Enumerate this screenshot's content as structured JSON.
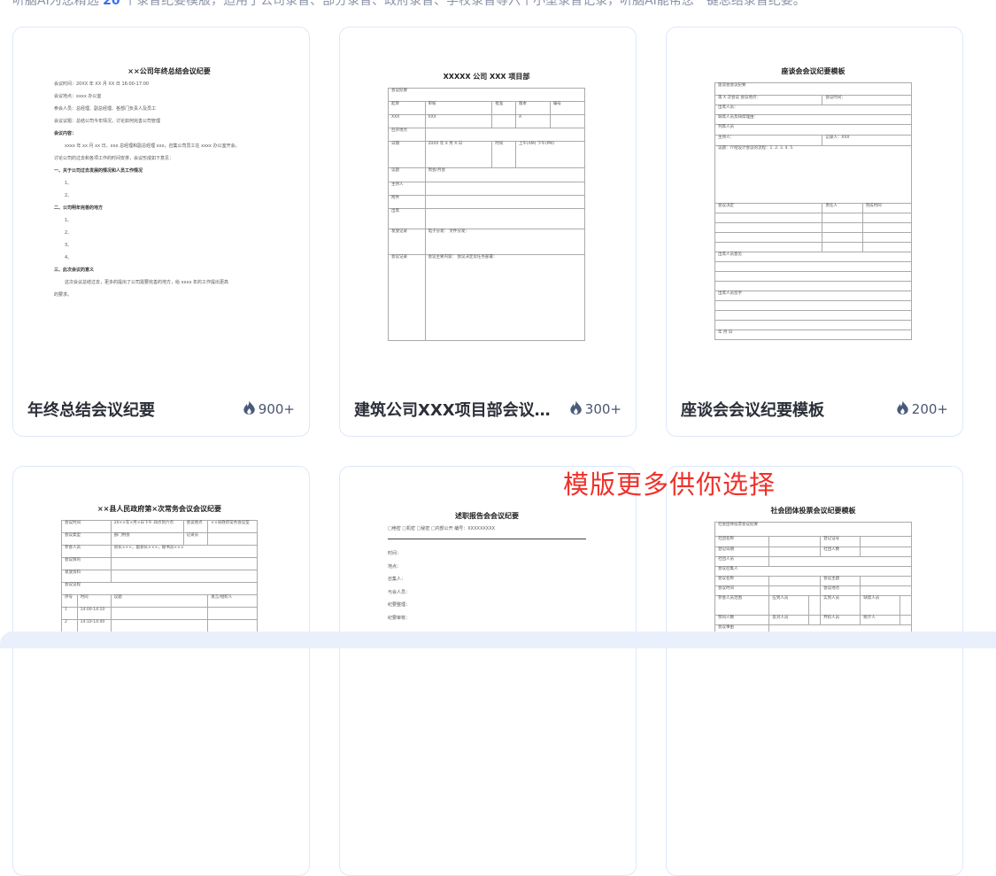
{
  "intro": {
    "prefix": "听脑AI为您精选",
    "count": "20",
    "suffix": "个录音纪要模版，适用于公司录音、部分录音、政府录音、学校录音等六个小型录音记录，听脑AI能帮您一键总结录音纪要。"
  },
  "promo_text": "模版更多供你选择",
  "colors": {
    "accent": "#3a6ff0",
    "promo": "#f0302a",
    "card_border": "#dde8fb",
    "band": "#e9f0fb"
  },
  "cards": [
    {
      "title": "年终总结会议纪要",
      "count": "900+",
      "icon": "flame-icon",
      "doc": {
        "type": "text",
        "title": "××公司年终总结会议纪要",
        "lines": [
          {
            "t": "会议时间：20XX 年 XX 月 XX 日 16:00-17:00"
          },
          {
            "t": "会议地点：xxxx 办公室"
          },
          {
            "t": "参会人员：总经理、副总经理、各部门负责人及员工"
          },
          {
            "t": "会议议题：总结公司今年情况，讨论如何完善公司管理"
          },
          {
            "t": "会议内容：",
            "b": true
          },
          {
            "t": "xxxx 年 xx 月 xx 日，xxx 总经理和副总经理 xxx，召集公司员工在 xxxx 办公室开会，",
            "i": true
          },
          {
            "t": "讨论公司的过去和各项工作的时间安排，会议形成如下意见："
          },
          {
            "t": "一、关于公司过去发展的情况和人员工作情况",
            "b": true
          },
          {
            "t": "1、",
            "i": true
          },
          {
            "t": "2、",
            "i": true
          },
          {
            "t": "二、公司明年完善的地方",
            "b": true
          },
          {
            "t": "1、",
            "i": true
          },
          {
            "t": "2、",
            "i": true
          },
          {
            "t": "3、",
            "i": true
          },
          {
            "t": "4、",
            "i": true
          },
          {
            "t": "三、此次会议的意义",
            "b": true
          },
          {
            "t": "这次会议总结过去，更多的提出了公司需要完善的地方，给 xxxx 年的工作提出更高",
            "i": true
          },
          {
            "t": "的要求。"
          }
        ]
      }
    },
    {
      "title": "建筑公司XXX项目部会议纪要",
      "count": "300+",
      "icon": "flame-icon",
      "doc": {
        "type": "table",
        "title": "XXXXX 公司 XXX 项目部",
        "rows": [
          [
            {
              "t": "会议纪要",
              "s": 5
            }
          ],
          [
            {
              "t": "起草"
            },
            {
              "t": "审核"
            },
            {
              "t": "批准"
            },
            {
              "t": "版本"
            },
            {
              "t": "编号"
            }
          ],
          [
            {
              "t": "XXX"
            },
            {
              "t": "XXX"
            },
            {
              "t": ""
            },
            {
              "t": "A"
            },
            {
              "t": ""
            }
          ],
          [
            {
              "t": "召开地点"
            },
            {
              "t": "",
              "s": 4
            }
          ],
          [
            {
              "t": "日期"
            },
            {
              "t": "20XX 年 X 月 X 日"
            },
            {
              "t": "时间"
            },
            {
              "t": "上午(AM)  下午(PM)",
              "s": 2
            }
          ],
          [
            {
              "t": "议题"
            },
            {
              "t": "周会/月会",
              "s": 4
            }
          ],
          [
            {
              "t": "主持人"
            },
            {
              "t": "",
              "s": 4
            }
          ],
          [
            {
              "t": "附件"
            },
            {
              "t": "",
              "s": 4
            }
          ],
          [
            {
              "t": "出席"
            },
            {
              "t": "",
              "s": 4
            }
          ],
          [
            {
              "t": "发放记录"
            },
            {
              "t": "电子分发：  文件分发：",
              "s": 4
            }
          ],
          [
            {
              "t": "会议记录"
            },
            {
              "t": "会议主要内容：  会议决定及任务部署：",
              "s": 4
            }
          ]
        ]
      }
    },
    {
      "title": "座谈会会议纪要模板",
      "count": "200+",
      "icon": "flame-icon",
      "doc": {
        "type": "table",
        "title": "座谈会会议纪要模板",
        "rows": [
          [
            {
              "t": "座谈会会议纪要",
              "s": 3
            }
          ],
          [
            {
              "t": "第 X 次会议  会议地点："
            },
            {
              "t": "会议时间：",
              "s": 2
            }
          ],
          [
            {
              "t": "出席人员：",
              "s": 3
            }
          ],
          [
            {
              "t": "缺席人员及缺席理由：",
              "s": 3
            }
          ],
          [
            {
              "t": "列席人员",
              "s": 3
            }
          ],
          [
            {
              "t": "主持人："
            },
            {
              "t": "记录人：XXX",
              "s": 2
            }
          ],
          [
            {
              "t": "议题：介绍设计会议的流程：1. 2. 3. 4. 5.",
              "s": 3
            }
          ],
          [
            {
              "t": "会议决定"
            },
            {
              "t": "责任人"
            },
            {
              "t": "完成时间"
            }
          ],
          [
            {
              "t": ""
            },
            {
              "t": ""
            },
            {
              "t": ""
            }
          ],
          [
            {
              "t": ""
            },
            {
              "t": ""
            },
            {
              "t": ""
            }
          ],
          [
            {
              "t": ""
            },
            {
              "t": ""
            },
            {
              "t": ""
            }
          ],
          [
            {
              "t": ""
            },
            {
              "t": ""
            },
            {
              "t": ""
            }
          ],
          [
            {
              "t": "出席人员意见",
              "s": 3
            }
          ],
          [
            {
              "t": "",
              "s": 3
            }
          ],
          [
            {
              "t": "",
              "s": 3
            }
          ],
          [
            {
              "t": "",
              "s": 3
            }
          ],
          [
            {
              "t": "出席人员签字",
              "s": 3
            }
          ],
          [
            {
              "t": "",
              "s": 3
            }
          ],
          [
            {
              "t": "",
              "s": 3
            }
          ],
          [
            {
              "t": "",
              "s": 3
            }
          ],
          [
            {
              "t": "年  月  日",
              "s": 3
            }
          ]
        ]
      }
    },
    {
      "title": "",
      "count": "",
      "icon": "",
      "doc": {
        "type": "table",
        "title": "××县人民政府第×次常务会议会议纪要",
        "rows": [
          [
            {
              "t": "会议时间",
              "s": 2
            },
            {
              "t": "20××年×月×日下午 四点到六点"
            },
            {
              "t": "会议地点"
            },
            {
              "t": "××县政府常务会议室"
            }
          ],
          [
            {
              "t": "会议类型",
              "s": 2
            },
            {
              "t": "部门例会"
            },
            {
              "t": "记录员"
            },
            {
              "t": ""
            }
          ],
          [
            {
              "t": "参会人员",
              "s": 2
            },
            {
              "t": "县长×××，副县长×××，秘书员×××",
              "s": 3
            }
          ],
          [
            {
              "t": "会议目的",
              "s": 2
            },
            {
              "t": "",
              "s": 3
            }
          ],
          [
            {
              "t": "发放资料",
              "s": 2
            },
            {
              "t": "",
              "s": 3
            }
          ],
          [
            {
              "t": "会议议程",
              "s": 5
            }
          ],
          [
            {
              "t": "序号"
            },
            {
              "t": "时间"
            },
            {
              "t": "议题",
              "s": 2
            },
            {
              "t": "发言/组织人"
            }
          ],
          [
            {
              "t": "1"
            },
            {
              "t": "14:00-14:10"
            },
            {
              "t": "",
              "s": 2
            },
            {
              "t": ""
            }
          ],
          [
            {
              "t": "2"
            },
            {
              "t": "14:10-14:40"
            },
            {
              "t": "",
              "s": 2
            },
            {
              "t": ""
            }
          ]
        ]
      }
    },
    {
      "title": "",
      "count": "",
      "icon": "",
      "doc": {
        "type": "text",
        "title": "述职报告会会议纪要",
        "header": "□绝密  □机密  □秘密  □内部公开  编号：XXXXXXXXX",
        "lines": [
          {
            "t": "时间："
          },
          {
            "t": "地点："
          },
          {
            "t": "召集人："
          },
          {
            "t": "与会人员："
          },
          {
            "t": "纪要整理："
          },
          {
            "t": "纪要审核："
          }
        ]
      }
    },
    {
      "title": "",
      "count": "",
      "icon": "",
      "doc": {
        "type": "table",
        "title": "社会团体投票会议纪要模板",
        "rows": [
          [
            {
              "t": "社会团体投票会议纪要",
              "s": 6
            }
          ],
          [
            {
              "t": "社团名称"
            },
            {
              "t": "",
              "s": 2
            },
            {
              "t": "登记证号"
            },
            {
              "t": "",
              "s": 2
            }
          ],
          [
            {
              "t": "登记日期"
            },
            {
              "t": "",
              "s": 2
            },
            {
              "t": "社团人数"
            },
            {
              "t": "",
              "s": 2
            }
          ],
          [
            {
              "t": "社团人员"
            },
            {
              "t": "",
              "s": 5
            }
          ],
          [
            {
              "t": "会议召集人",
              "s": 6
            }
          ],
          [
            {
              "t": "会议名称"
            },
            {
              "t": "",
              "s": 2
            },
            {
              "t": "会议主题"
            },
            {
              "t": "",
              "s": 2
            }
          ],
          [
            {
              "t": "会议时间"
            },
            {
              "t": "",
              "s": 2
            },
            {
              "t": "会议地点"
            },
            {
              "t": "",
              "s": 2
            }
          ],
          [
            {
              "t": "参会人员范围"
            },
            {
              "t": "应到人员"
            },
            {
              "t": ""
            },
            {
              "t": "实到人员"
            },
            {
              "t": "缺席人员"
            },
            {
              "t": ""
            }
          ],
          [
            {
              "t": "赞同人数"
            },
            {
              "t": "反对人员"
            },
            {
              "t": ""
            },
            {
              "t": "弃权人员"
            },
            {
              "t": "统计人"
            },
            {
              "t": ""
            }
          ],
          [
            {
              "t": "会议事由"
            },
            {
              "t": "",
              "s": 5
            }
          ]
        ]
      }
    }
  ]
}
